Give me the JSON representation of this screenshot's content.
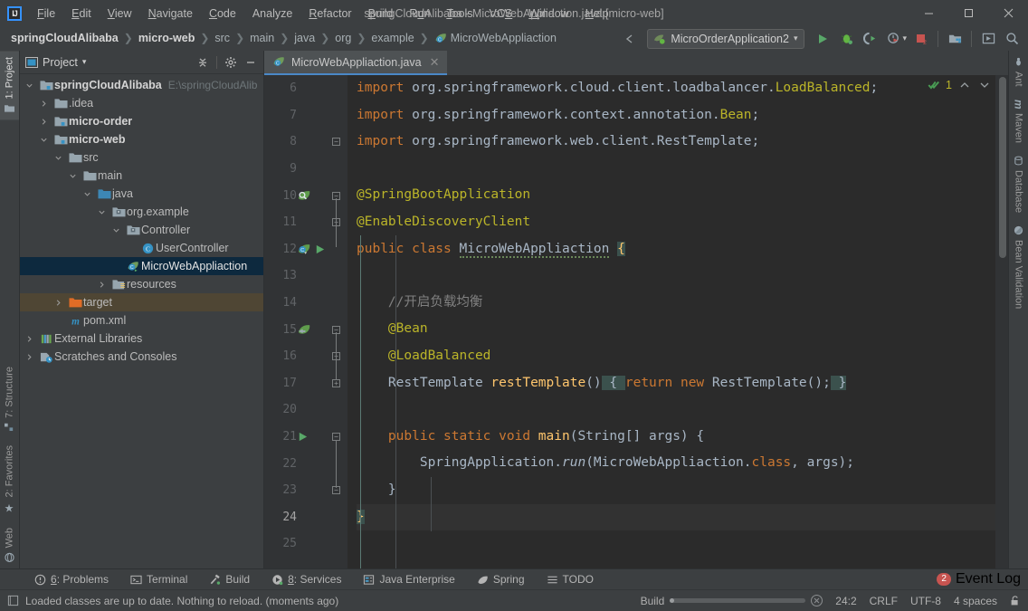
{
  "window": {
    "title": "springCloudAlibaba - MicroWebAppliaction.java [micro-web]",
    "minimize": "—",
    "maximize": "☐",
    "close": "✕",
    "logo": "IJ"
  },
  "menu": [
    {
      "label": "File",
      "mnemonic": "F"
    },
    {
      "label": "Edit",
      "mnemonic": "E"
    },
    {
      "label": "View",
      "mnemonic": "V"
    },
    {
      "label": "Navigate",
      "mnemonic": "N"
    },
    {
      "label": "Code",
      "mnemonic": "C"
    },
    {
      "label": "Analyze",
      "mnemonic": ""
    },
    {
      "label": "Refactor",
      "mnemonic": "R"
    },
    {
      "label": "Build",
      "mnemonic": "B"
    },
    {
      "label": "Run",
      "mnemonic": "u"
    },
    {
      "label": "Tools",
      "mnemonic": "T"
    },
    {
      "label": "VCS",
      "mnemonic": "S"
    },
    {
      "label": "Window",
      "mnemonic": "W"
    },
    {
      "label": "Help",
      "mnemonic": "H"
    }
  ],
  "breadcrumb": {
    "separator": "❯",
    "items": [
      {
        "label": "springCloudAlibaba",
        "bold": true
      },
      {
        "label": "micro-web",
        "bold": true
      },
      {
        "label": "src",
        "bold": false
      },
      {
        "label": "main",
        "bold": false
      },
      {
        "label": "java",
        "bold": false
      },
      {
        "label": "org",
        "bold": false
      },
      {
        "label": "example",
        "bold": false
      },
      {
        "label": "MicroWebAppliaction",
        "bold": false,
        "icon": "spring-class-icon"
      }
    ]
  },
  "toolbar": {
    "run_configuration": "MicroOrderApplication2",
    "dropdown_caret": "▾",
    "buttons": [
      {
        "name": "run-button",
        "glyph": "▶",
        "color": "#59a869"
      },
      {
        "name": "debug-button",
        "glyph": "bug",
        "color": "#62b543"
      },
      {
        "name": "run-coverage-button",
        "glyph": "coverage",
        "color": "#9aa7b0"
      },
      {
        "name": "profiler-button",
        "glyph": "profile",
        "color": "#9aa7b0"
      },
      {
        "name": "stop-button",
        "glyph": "■",
        "color": "#c75450"
      },
      {
        "name": "update-project-button",
        "glyph": "folder",
        "color": "#9aa7b0"
      },
      {
        "name": "select-opened-file-button",
        "glyph": "target",
        "color": "#9aa7b0"
      },
      {
        "name": "search-everywhere-button",
        "glyph": "search",
        "color": "#9aa7b0"
      }
    ]
  },
  "left_stripe": {
    "top": [
      {
        "label": "1: Project",
        "mnemonic": "1",
        "selected": true
      }
    ],
    "bottom": [
      {
        "label": "7: Structure",
        "mnemonic": "7",
        "selected": false
      },
      {
        "label": "2: Favorites",
        "mnemonic": "2",
        "selected": false
      },
      {
        "label": "Web",
        "mnemonic": "",
        "selected": false
      }
    ]
  },
  "right_stripe": {
    "items": [
      {
        "label": "Ant"
      },
      {
        "label": "Maven"
      },
      {
        "label": "Database"
      },
      {
        "label": "Bean Validation"
      }
    ]
  },
  "project_panel": {
    "title": "Project",
    "caret": "▾",
    "actions": [
      {
        "name": "collapse-all-button",
        "tooltip": "Collapse All"
      },
      {
        "name": "settings-gear-button",
        "tooltip": "Settings"
      },
      {
        "name": "hide-panel-button",
        "tooltip": "Hide"
      }
    ],
    "tree": [
      {
        "depth": 0,
        "arrow": "v",
        "icon": "module-folder-icon",
        "label": "springCloudAlibaba",
        "bold": true,
        "path": "E:\\springCloudAlib",
        "state": "normal"
      },
      {
        "depth": 1,
        "arrow": ">",
        "icon": "folder-icon",
        "label": ".idea",
        "bold": false,
        "state": "normal"
      },
      {
        "depth": 1,
        "arrow": ">",
        "icon": "module-folder-icon",
        "label": "micro-order",
        "bold": true,
        "state": "normal"
      },
      {
        "depth": 1,
        "arrow": "v",
        "icon": "module-folder-icon",
        "label": "micro-web",
        "bold": true,
        "state": "normal"
      },
      {
        "depth": 2,
        "arrow": "v",
        "icon": "folder-icon",
        "label": "src",
        "bold": false,
        "state": "normal"
      },
      {
        "depth": 3,
        "arrow": "v",
        "icon": "folder-icon",
        "label": "main",
        "bold": false,
        "state": "normal"
      },
      {
        "depth": 4,
        "arrow": "v",
        "icon": "source-folder-icon",
        "label": "java",
        "bold": false,
        "state": "normal"
      },
      {
        "depth": 5,
        "arrow": "v",
        "icon": "package-icon",
        "label": "org.example",
        "bold": false,
        "state": "normal"
      },
      {
        "depth": 6,
        "arrow": "v",
        "icon": "package-icon",
        "label": "Controller",
        "bold": false,
        "state": "normal"
      },
      {
        "depth": 7,
        "arrow": "",
        "icon": "java-class-icon",
        "label": "UserController",
        "bold": false,
        "state": "normal"
      },
      {
        "depth": 6,
        "arrow": "",
        "icon": "spring-class-icon",
        "label": "MicroWebAppliaction",
        "bold": false,
        "state": "selected"
      },
      {
        "depth": 5,
        "arrow": ">",
        "icon": "resource-folder-icon",
        "label": "resources",
        "bold": false,
        "state": "normal"
      },
      {
        "depth": 2,
        "arrow": ">",
        "icon": "target-folder-icon",
        "label": "target",
        "bold": false,
        "state": "marked"
      },
      {
        "depth": 2,
        "arrow": "",
        "icon": "maven-icon",
        "label": "pom.xml",
        "bold": false,
        "state": "normal"
      },
      {
        "depth": 0,
        "arrow": ">",
        "icon": "libraries-icon",
        "label": "External Libraries",
        "bold": false,
        "state": "normal"
      },
      {
        "depth": 0,
        "arrow": ">",
        "icon": "scratches-icon",
        "label": "Scratches and Consoles",
        "bold": false,
        "state": "normal"
      }
    ]
  },
  "editor": {
    "tab": {
      "label": "MicroWebAppliaction.java",
      "icon": "spring-class-icon",
      "close": "✕"
    },
    "inspection_widget": {
      "icon": "inspection-ok-icon",
      "count": "1",
      "up": "⌃",
      "down": "⌄"
    },
    "first_line_number": 6,
    "lines": [
      {
        "num": 6,
        "text": "import org.springframework.cloud.client.loadbalancer.LoadBalanced;"
      },
      {
        "num": 7,
        "text": "import org.springframework.context.annotation.Bean;"
      },
      {
        "num": 8,
        "text": "import org.springframework.web.client.RestTemplate;"
      },
      {
        "num": 9,
        "text": ""
      },
      {
        "num": 10,
        "text": "@SpringBootApplication"
      },
      {
        "num": 11,
        "text": "@EnableDiscoveryClient"
      },
      {
        "num": 12,
        "text": "public class MicroWebAppliaction {"
      },
      {
        "num": 13,
        "text": ""
      },
      {
        "num": 14,
        "text": "    //开启负载均衡"
      },
      {
        "num": 15,
        "text": "    @Bean"
      },
      {
        "num": 16,
        "text": "    @LoadBalanced"
      },
      {
        "num": 17,
        "text": "    RestTemplate restTemplate() { return new RestTemplate(); }"
      },
      {
        "num": 20,
        "text": ""
      },
      {
        "num": 21,
        "text": "    public static void main(String[] args) {"
      },
      {
        "num": 22,
        "text": "        SpringApplication.run(MicroWebAppliaction.class, args);"
      },
      {
        "num": 23,
        "text": "    }"
      },
      {
        "num": 24,
        "text": "}"
      },
      {
        "num": 25,
        "text": ""
      }
    ],
    "gutter_icons": [
      {
        "line": 10,
        "icon": "spring-config-search-icon"
      },
      {
        "line": 12,
        "icon": "spring-bean-icon"
      },
      {
        "line": 12,
        "icon": "run-gutter-icon"
      },
      {
        "line": 15,
        "icon": "spring-bean-override-icon"
      },
      {
        "line": 21,
        "icon": "run-gutter-icon"
      }
    ]
  },
  "bottom_tabs": [
    {
      "label": "6: Problems",
      "mnemonic": "6",
      "icon": "problems-icon"
    },
    {
      "label": "Terminal",
      "mnemonic": "",
      "icon": "terminal-icon"
    },
    {
      "label": "Build",
      "mnemonic": "",
      "icon": "build-hammer-icon"
    },
    {
      "label": "8: Services",
      "mnemonic": "8",
      "icon": "services-icon"
    },
    {
      "label": "Java Enterprise",
      "mnemonic": "",
      "icon": "java-enterprise-icon"
    },
    {
      "label": "Spring",
      "mnemonic": "",
      "icon": "spring-leaf-icon"
    },
    {
      "label": "TODO",
      "mnemonic": "",
      "icon": "todo-icon"
    }
  ],
  "event_log": {
    "label": "Event Log",
    "badge": "2"
  },
  "statusbar": {
    "message": "Loaded classes are up to date. Nothing to reload. (moments ago)",
    "message_icon": "memory-indicator-icon",
    "progress_label": "Build",
    "progress_cancel": "✕",
    "caret_position": "24:2",
    "line_separator": "CRLF",
    "encoding": "UTF-8",
    "indent": "4 spaces",
    "lock_icon": "read-write-lock-icon"
  }
}
